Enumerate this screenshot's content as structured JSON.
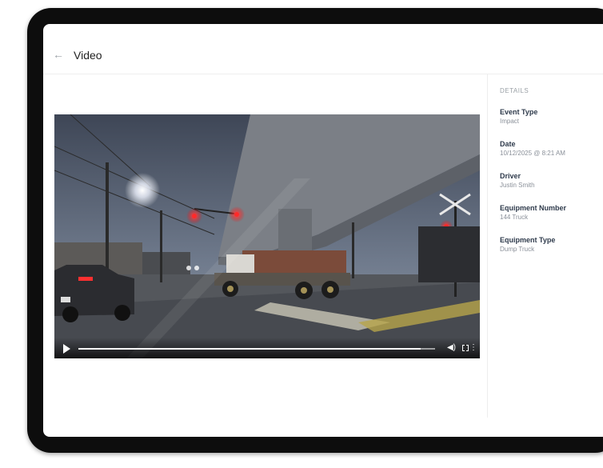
{
  "header": {
    "back_icon": "arrow-left-icon",
    "back_glyph": "←",
    "title": "Video"
  },
  "details": {
    "heading": "DETAILS",
    "items": [
      {
        "label": "Event Type",
        "value": "Impact"
      },
      {
        "label": "Date",
        "value": "10/12/2025 @ 8:21 AM"
      },
      {
        "label": "Driver",
        "value": "Justin Smith"
      },
      {
        "label": "Equipment Number",
        "value": "144 Truck"
      },
      {
        "label": "Equipment Type",
        "value": "Dump Truck"
      }
    ]
  },
  "player": {
    "progress": 0.96,
    "icons": [
      "play-icon",
      "volume-icon",
      "fullscreen-icon",
      "more-icon"
    ],
    "volume_glyph": "◀)",
    "more_glyph": "⋮"
  },
  "colors": {
    "accent_text": "#2f3b4c",
    "muted_text": "#8a9099",
    "traffic_light": "#ff2a2a"
  }
}
